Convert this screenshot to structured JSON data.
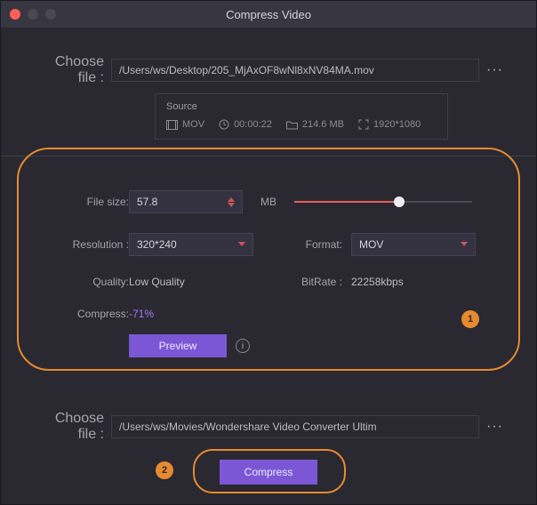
{
  "window": {
    "title": "Compress Video"
  },
  "input": {
    "choose_label": "Choose file :",
    "path": "/Users/ws/Desktop/205_MjAxOF8wNl8xNV84MA.mov"
  },
  "source": {
    "heading": "Source",
    "format": "MOV",
    "duration": "00:00:22",
    "size": "214.6 MB",
    "resolution": "1920*1080"
  },
  "settings": {
    "file_size_label": "File size:",
    "file_size_value": "57.8",
    "file_size_unit": "MB",
    "resolution_label": "Resolution :",
    "resolution_value": "320*240",
    "format_label": "Format:",
    "format_value": "MOV",
    "quality_label": "Quality:",
    "quality_value": "Low Quality",
    "bitrate_label": "BitRate :",
    "bitrate_value": "22258kbps",
    "compress_label": "Compress:",
    "compress_value": "-71%",
    "preview_label": "Preview"
  },
  "output": {
    "choose_label": "Choose file :",
    "path": "/Users/ws/Movies/Wondershare Video Converter Ultim"
  },
  "action": {
    "compress_label": "Compress"
  },
  "annotations": {
    "one": "1",
    "two": "2"
  }
}
